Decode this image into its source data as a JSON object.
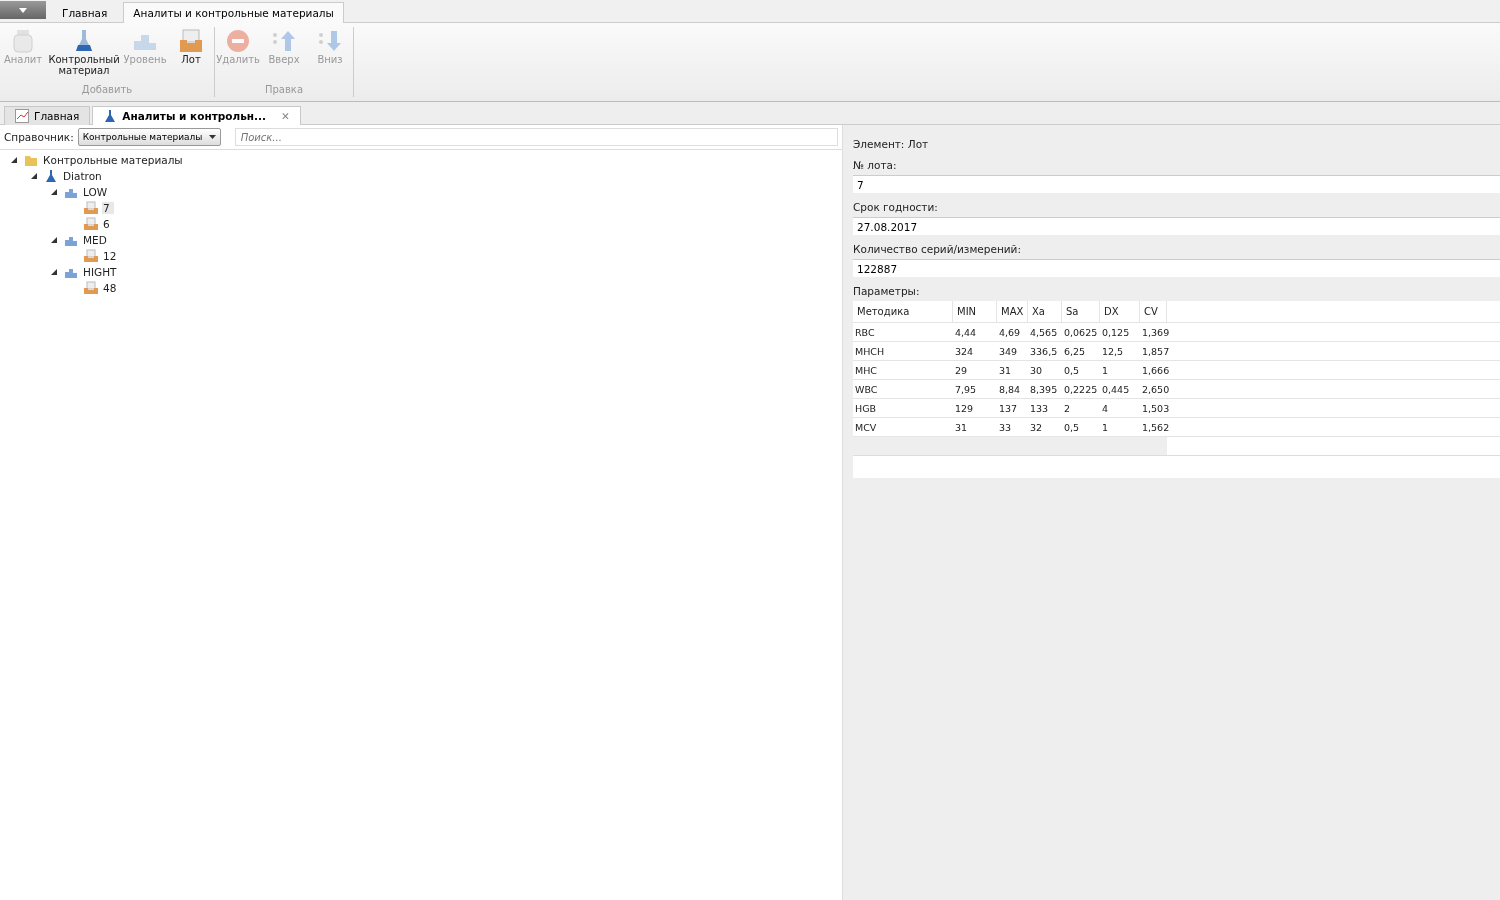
{
  "ribbon_tabs": [
    {
      "label": "Главная",
      "selected": false
    },
    {
      "label": "Аналиты и контрольные материалы",
      "selected": true
    }
  ],
  "ribbon_groups": [
    {
      "label": "Добавить",
      "buttons": [
        {
          "label": "Аналит",
          "disabled": true
        },
        {
          "label": "Контрольный материал",
          "disabled": false
        },
        {
          "label": "Уровень",
          "disabled": true
        },
        {
          "label": "Лот",
          "disabled": false
        }
      ]
    },
    {
      "label": "Правка",
      "buttons": [
        {
          "label": "Удалить",
          "disabled": true
        },
        {
          "label": "Вверх",
          "disabled": true
        },
        {
          "label": "Вниз",
          "disabled": true
        }
      ]
    }
  ],
  "doc_tabs": [
    {
      "label": "Главная",
      "selected": false
    },
    {
      "label": "Аналиты и контрольн...",
      "selected": true,
      "close": "✕"
    }
  ],
  "directory": {
    "label": "Справочник:",
    "value": "Контрольные материалы"
  },
  "search": {
    "placeholder": "Поиск..."
  },
  "tree": [
    {
      "label": "Контрольные материалы",
      "kind": "folder",
      "expanded": true,
      "selected": false,
      "children": [
        {
          "label": "Diatron",
          "kind": "flask",
          "expanded": true,
          "selected": false,
          "children": [
            {
              "label": "LOW",
              "kind": "level",
              "expanded": true,
              "selected": false,
              "children": [
                {
                  "label": "7",
                  "kind": "lot",
                  "selected": true
                },
                {
                  "label": "6",
                  "kind": "lot",
                  "selected": false
                }
              ]
            },
            {
              "label": "MED",
              "kind": "level",
              "expanded": true,
              "selected": false,
              "children": [
                {
                  "label": "12",
                  "kind": "lot",
                  "selected": false
                }
              ]
            },
            {
              "label": "HIGHT",
              "kind": "level",
              "expanded": true,
              "selected": false,
              "children": [
                {
                  "label": "48",
                  "kind": "lot",
                  "selected": false
                }
              ]
            }
          ]
        }
      ]
    }
  ],
  "details": {
    "element_label": "Элемент:",
    "element_value": "Лот",
    "fields": [
      {
        "label": "№ лота:",
        "value": "7"
      },
      {
        "label": "Срок годности:",
        "value": "27.08.2017"
      },
      {
        "label": "Количество серий/измерений:",
        "value": "122887"
      }
    ],
    "params_label": "Параметры:",
    "table": {
      "columns": [
        "Методика",
        "MIN",
        "MAX",
        "Xa",
        "Sa",
        "DX",
        "CV"
      ],
      "rows": [
        [
          "RBC",
          "4,44",
          "4,69",
          "4,565",
          "0,0625",
          "0,125",
          "1,369"
        ],
        [
          "MHCH",
          "324",
          "349",
          "336,5",
          "6,25",
          "12,5",
          "1,857"
        ],
        [
          "MHC",
          "29",
          "31",
          "30",
          "0,5",
          "1",
          "1,666"
        ],
        [
          "WBC",
          "7,95",
          "8,84",
          "8,395",
          "0,2225",
          "0,445",
          "2,650"
        ],
        [
          "HGB",
          "129",
          "137",
          "133",
          "2",
          "4",
          "1,503"
        ],
        [
          "MCV",
          "31",
          "33",
          "32",
          "0,5",
          "1",
          "1,562"
        ]
      ]
    }
  }
}
